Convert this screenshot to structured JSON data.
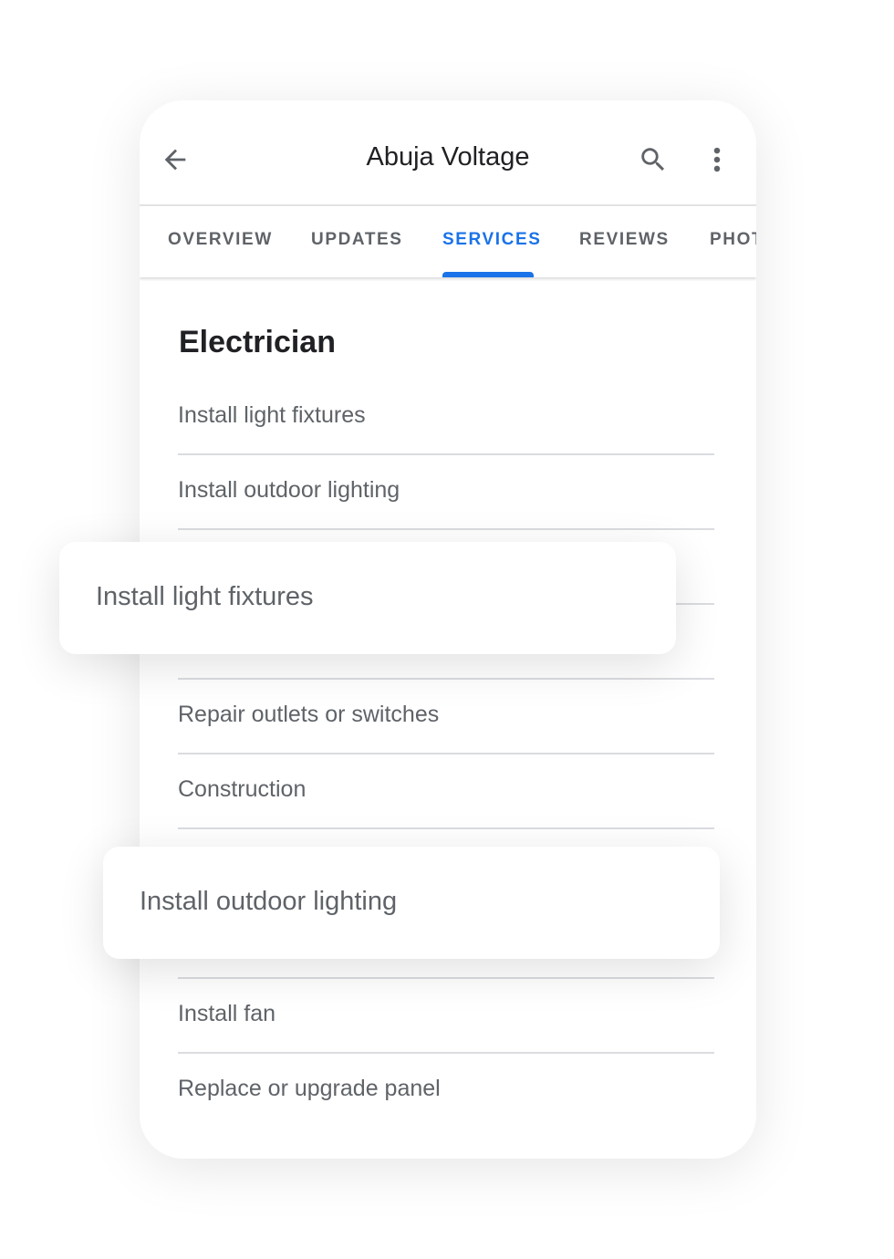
{
  "appbar": {
    "title": "Abuja Voltage",
    "back_icon": "arrow-back-icon",
    "search_icon": "search-icon",
    "more_icon": "more-vert-icon"
  },
  "tabs": [
    {
      "label": "OVERVIEW"
    },
    {
      "label": "UPDATES"
    },
    {
      "label": "SERVICES",
      "active": true
    },
    {
      "label": "REVIEWS"
    },
    {
      "label": "PHOTOS"
    }
  ],
  "colors": {
    "accent": "#1a73e8",
    "text": "#5f6368",
    "heading": "#202124"
  },
  "section": {
    "title": "Electrician"
  },
  "services": [
    "Install light fixtures",
    "Install outdoor lighting",
    "",
    "",
    "Repair outlets or switches",
    "Construction",
    "",
    "",
    "Install fan",
    "Replace or upgrade panel"
  ],
  "floating_cards": [
    "Install light fixtures",
    "Install outdoor lighting"
  ]
}
